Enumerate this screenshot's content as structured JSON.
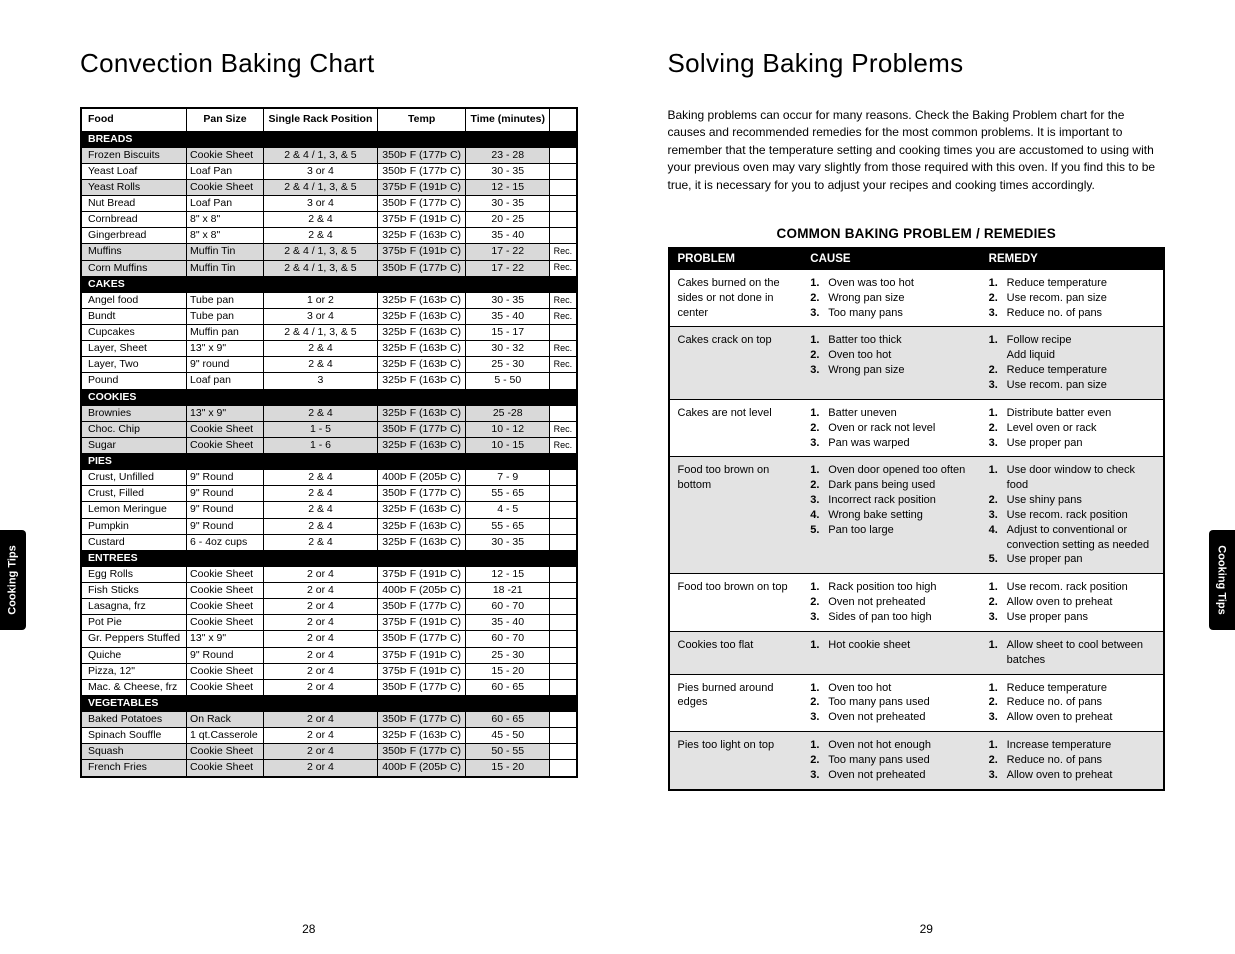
{
  "sideTab": "Cooking Tips",
  "leftTitle": "Convection Baking Chart",
  "rightTitle": "Solving Baking Problems",
  "rightIntro": "Baking problems can occur for many reasons.  Check the Baking Problem chart for the causes and recommended remedies for the most common problems. It is important to remember that the temperature setting and cooking times you are accustomed to using with your previous oven may vary slightly from those required with this oven. If you find this to be true, it is necessary for you to adjust your recipes and cooking times accordingly.",
  "problemsHeading": "COMMON BAKING PROBLEM / REMEDIES",
  "pageLeftNum": "28",
  "pageRightNum": "29",
  "chart_data": {
    "type": "table",
    "columns": [
      "Food",
      "Pan Size",
      "Single Rack Position",
      "Temp",
      "Time (minutes)",
      ""
    ],
    "sections": [
      {
        "name": "BREADS",
        "rows": [
          {
            "food": "Frozen Biscuits",
            "pan": "Cookie Sheet",
            "pos": "2 & 4 / 1, 3, & 5",
            "temp": "350Þ F (177Þ C)",
            "time": "23 - 28",
            "rec": "",
            "shaded": true
          },
          {
            "food": "Yeast Loaf",
            "pan": "Loaf Pan",
            "pos": "3 or 4",
            "temp": "350Þ F (177Þ C)",
            "time": "30 - 35",
            "rec": ""
          },
          {
            "food": "Yeast Rolls",
            "pan": "Cookie Sheet",
            "pos": "2 & 4 / 1, 3, & 5",
            "temp": "375Þ F (191Þ C)",
            "time": "12 - 15",
            "rec": "",
            "shaded": true
          },
          {
            "food": "Nut Bread",
            "pan": "Loaf Pan",
            "pos": "3 or 4",
            "temp": "350Þ F (177Þ C)",
            "time": "30 - 35",
            "rec": ""
          },
          {
            "food": "Cornbread",
            "pan": "8\" x 8\"",
            "pos": "2 & 4",
            "temp": "375Þ F (191Þ C)",
            "time": "20 - 25",
            "rec": ""
          },
          {
            "food": "Gingerbread",
            "pan": "8\" x 8\"",
            "pos": "2 & 4",
            "temp": "325Þ F (163Þ C)",
            "time": "35 - 40",
            "rec": ""
          },
          {
            "food": "Muffins",
            "pan": "Muffin Tin",
            "pos": "2 & 4 / 1, 3, & 5",
            "temp": "375Þ F (191Þ C)",
            "time": "17 - 22",
            "rec": "Rec.",
            "shaded": true
          },
          {
            "food": "Corn Muffins",
            "pan": "Muffin Tin",
            "pos": "2 & 4 / 1, 3, & 5",
            "temp": "350Þ F (177Þ C)",
            "time": "17 - 22",
            "rec": "Rec.",
            "shaded": true
          }
        ]
      },
      {
        "name": "CAKES",
        "rows": [
          {
            "food": "Angel food",
            "pan": "Tube pan",
            "pos": "1 or 2",
            "temp": "325Þ F (163Þ C)",
            "time": "30 - 35",
            "rec": "Rec."
          },
          {
            "food": "Bundt",
            "pan": "Tube pan",
            "pos": "3 or 4",
            "temp": "325Þ F (163Þ C)",
            "time": "35 - 40",
            "rec": "Rec."
          },
          {
            "food": "Cupcakes",
            "pan": "Muffin pan",
            "pos": "2 & 4 / 1, 3, & 5",
            "temp": "325Þ F (163Þ C)",
            "time": "15 - 17",
            "rec": ""
          },
          {
            "food": "Layer, Sheet",
            "pan": "13\" x 9\"",
            "pos": "2 & 4",
            "temp": "325Þ F (163Þ C)",
            "time": "30 - 32",
            "rec": "Rec."
          },
          {
            "food": "Layer, Two",
            "pan": "9\" round",
            "pos": "2 & 4",
            "temp": "325Þ F (163Þ C)",
            "time": "25 - 30",
            "rec": "Rec."
          },
          {
            "food": "Pound",
            "pan": "Loaf pan",
            "pos": "3",
            "temp": "325Þ F (163Þ C)",
            "time": "5 - 50",
            "rec": ""
          }
        ]
      },
      {
        "name": "COOKIES",
        "rows": [
          {
            "food": "Brownies",
            "pan": "13\" x 9\"",
            "pos": "2 & 4",
            "temp": "325Þ F (163Þ C)",
            "time": "25 -28",
            "rec": "",
            "shaded": true
          },
          {
            "food": "Choc. Chip",
            "pan": "Cookie Sheet",
            "pos": "1 - 5",
            "temp": "350Þ F (177Þ C)",
            "time": "10 - 12",
            "rec": "Rec.",
            "shaded": true
          },
          {
            "food": "Sugar",
            "pan": "Cookie Sheet",
            "pos": "1 - 6",
            "temp": "325Þ F (163Þ C)",
            "time": "10 - 15",
            "rec": "Rec.",
            "shaded": true
          }
        ]
      },
      {
        "name": "PIES",
        "rows": [
          {
            "food": "Crust, Unfilled",
            "pan": "9\" Round",
            "pos": "2 & 4",
            "temp": "400Þ F (205Þ C)",
            "time": "7 - 9",
            "rec": ""
          },
          {
            "food": "Crust, Filled",
            "pan": "9\" Round",
            "pos": "2 & 4",
            "temp": "350Þ F (177Þ C)",
            "time": "55 - 65",
            "rec": ""
          },
          {
            "food": "Lemon Meringue",
            "pan": "9\" Round",
            "pos": "2 & 4",
            "temp": "325Þ F (163Þ C)",
            "time": "4 - 5",
            "rec": ""
          },
          {
            "food": "Pumpkin",
            "pan": "9\" Round",
            "pos": "2 & 4",
            "temp": "325Þ F (163Þ C)",
            "time": "55 - 65",
            "rec": ""
          },
          {
            "food": "Custard",
            "pan": "6 - 4oz cups",
            "pos": "2 & 4",
            "temp": "325Þ F (163Þ C)",
            "time": "30 - 35",
            "rec": ""
          }
        ]
      },
      {
        "name": "ENTREES",
        "rows": [
          {
            "food": "Egg Rolls",
            "pan": "Cookie Sheet",
            "pos": "2 or 4",
            "temp": "375Þ F (191Þ C)",
            "time": "12 - 15",
            "rec": ""
          },
          {
            "food": "Fish Sticks",
            "pan": "Cookie Sheet",
            "pos": "2 or 4",
            "temp": "400Þ F (205Þ C)",
            "time": "18 -21",
            "rec": ""
          },
          {
            "food": "Lasagna, frz",
            "pan": "Cookie Sheet",
            "pos": "2 or 4",
            "temp": "350Þ F (177Þ C)",
            "time": "60 - 70",
            "rec": ""
          },
          {
            "food": "Pot Pie",
            "pan": "Cookie Sheet",
            "pos": "2 or 4",
            "temp": "375Þ F (191Þ C)",
            "time": "35 - 40",
            "rec": ""
          },
          {
            "food": "Gr. Peppers Stuffed",
            "pan": "13\" x 9\"",
            "pos": "2 or 4",
            "temp": "350Þ F (177Þ C)",
            "time": "60 - 70",
            "rec": ""
          },
          {
            "food": "Quiche",
            "pan": "9\" Round",
            "pos": "2 or 4",
            "temp": "375Þ F (191Þ C)",
            "time": "25 - 30",
            "rec": ""
          },
          {
            "food": "Pizza, 12\"",
            "pan": "Cookie Sheet",
            "pos": "2 or 4",
            "temp": "375Þ F (191Þ C)",
            "time": "15 - 20",
            "rec": ""
          },
          {
            "food": "Mac. & Cheese, frz",
            "pan": "Cookie Sheet",
            "pos": "2 or 4",
            "temp": "350Þ F (177Þ C)",
            "time": "60 - 65",
            "rec": ""
          }
        ]
      },
      {
        "name": "VEGETABLES",
        "rows": [
          {
            "food": "Baked Potatoes",
            "pan": "On Rack",
            "pos": "2 or 4",
            "temp": "350Þ F (177Þ C)",
            "time": "60 - 65",
            "rec": "",
            "shaded": true
          },
          {
            "food": "Spinach Souffle",
            "pan": "1 qt.Casserole",
            "pos": "2 or 4",
            "temp": "325Þ F (163Þ C)",
            "time": "45 - 50",
            "rec": ""
          },
          {
            "food": "Squash",
            "pan": "Cookie Sheet",
            "pos": "2 or 4",
            "temp": "350Þ F (177Þ C)",
            "time": "50 - 55",
            "rec": "",
            "shaded": true
          },
          {
            "food": "French Fries",
            "pan": "Cookie Sheet",
            "pos": "2 or 4",
            "temp": "400Þ F (205Þ C)",
            "time": "15 - 20",
            "rec": "",
            "shaded": true
          }
        ]
      }
    ]
  },
  "problemsCols": [
    "PROBLEM",
    "CAUSE",
    "REMEDY"
  ],
  "problems": [
    {
      "shaded": false,
      "problem": "Cakes burned on the sides or not done in center",
      "cause": [
        "Oven was too hot",
        "Wrong pan size",
        "Too many pans"
      ],
      "remedy": [
        "Reduce temperature",
        "Use recom. pan size",
        "Reduce no. of pans"
      ]
    },
    {
      "shaded": true,
      "problem": "Cakes crack on top",
      "cause": [
        "Batter too thick",
        "Oven too hot",
        "Wrong pan size"
      ],
      "remedy": [
        "Follow recipe\nAdd liquid",
        "Reduce temperature",
        "Use recom. pan size"
      ]
    },
    {
      "shaded": false,
      "problem": "Cakes are not level",
      "cause": [
        "Batter uneven",
        "Oven or rack not level",
        "Pan was warped"
      ],
      "remedy": [
        "Distribute batter even",
        "Level oven or rack",
        "Use proper pan"
      ]
    },
    {
      "shaded": true,
      "problem": "Food too brown on bottom",
      "cause": [
        "Oven door opened too often",
        "Dark pans being used",
        "Incorrect rack position",
        "Wrong bake setting",
        "Pan too large"
      ],
      "remedy": [
        "Use door window to check food",
        "Use shiny pans",
        "Use recom. rack position",
        "Adjust to conventional or convection setting as needed",
        "Use proper pan"
      ]
    },
    {
      "shaded": false,
      "problem": "Food too brown on top",
      "cause": [
        "Rack position too high",
        "Oven not preheated",
        "Sides of pan too high"
      ],
      "remedy": [
        "Use recom. rack position",
        "Allow oven to preheat",
        "Use proper pans"
      ]
    },
    {
      "shaded": true,
      "problem": "Cookies too flat",
      "cause": [
        "Hot cookie sheet"
      ],
      "remedy": [
        "Allow sheet to cool between batches"
      ]
    },
    {
      "shaded": false,
      "problem": "Pies burned around edges",
      "cause": [
        "Oven too hot",
        "Too many pans used",
        "Oven not preheated"
      ],
      "remedy": [
        "Reduce temperature",
        "Reduce no. of pans",
        "Allow oven to preheat"
      ]
    },
    {
      "shaded": true,
      "problem": "Pies too light on top",
      "cause": [
        "Oven not hot enough",
        "Too many pans used",
        "Oven not preheated"
      ],
      "remedy": [
        "Increase temperature",
        "Reduce no. of pans",
        "Allow oven to preheat"
      ]
    }
  ]
}
